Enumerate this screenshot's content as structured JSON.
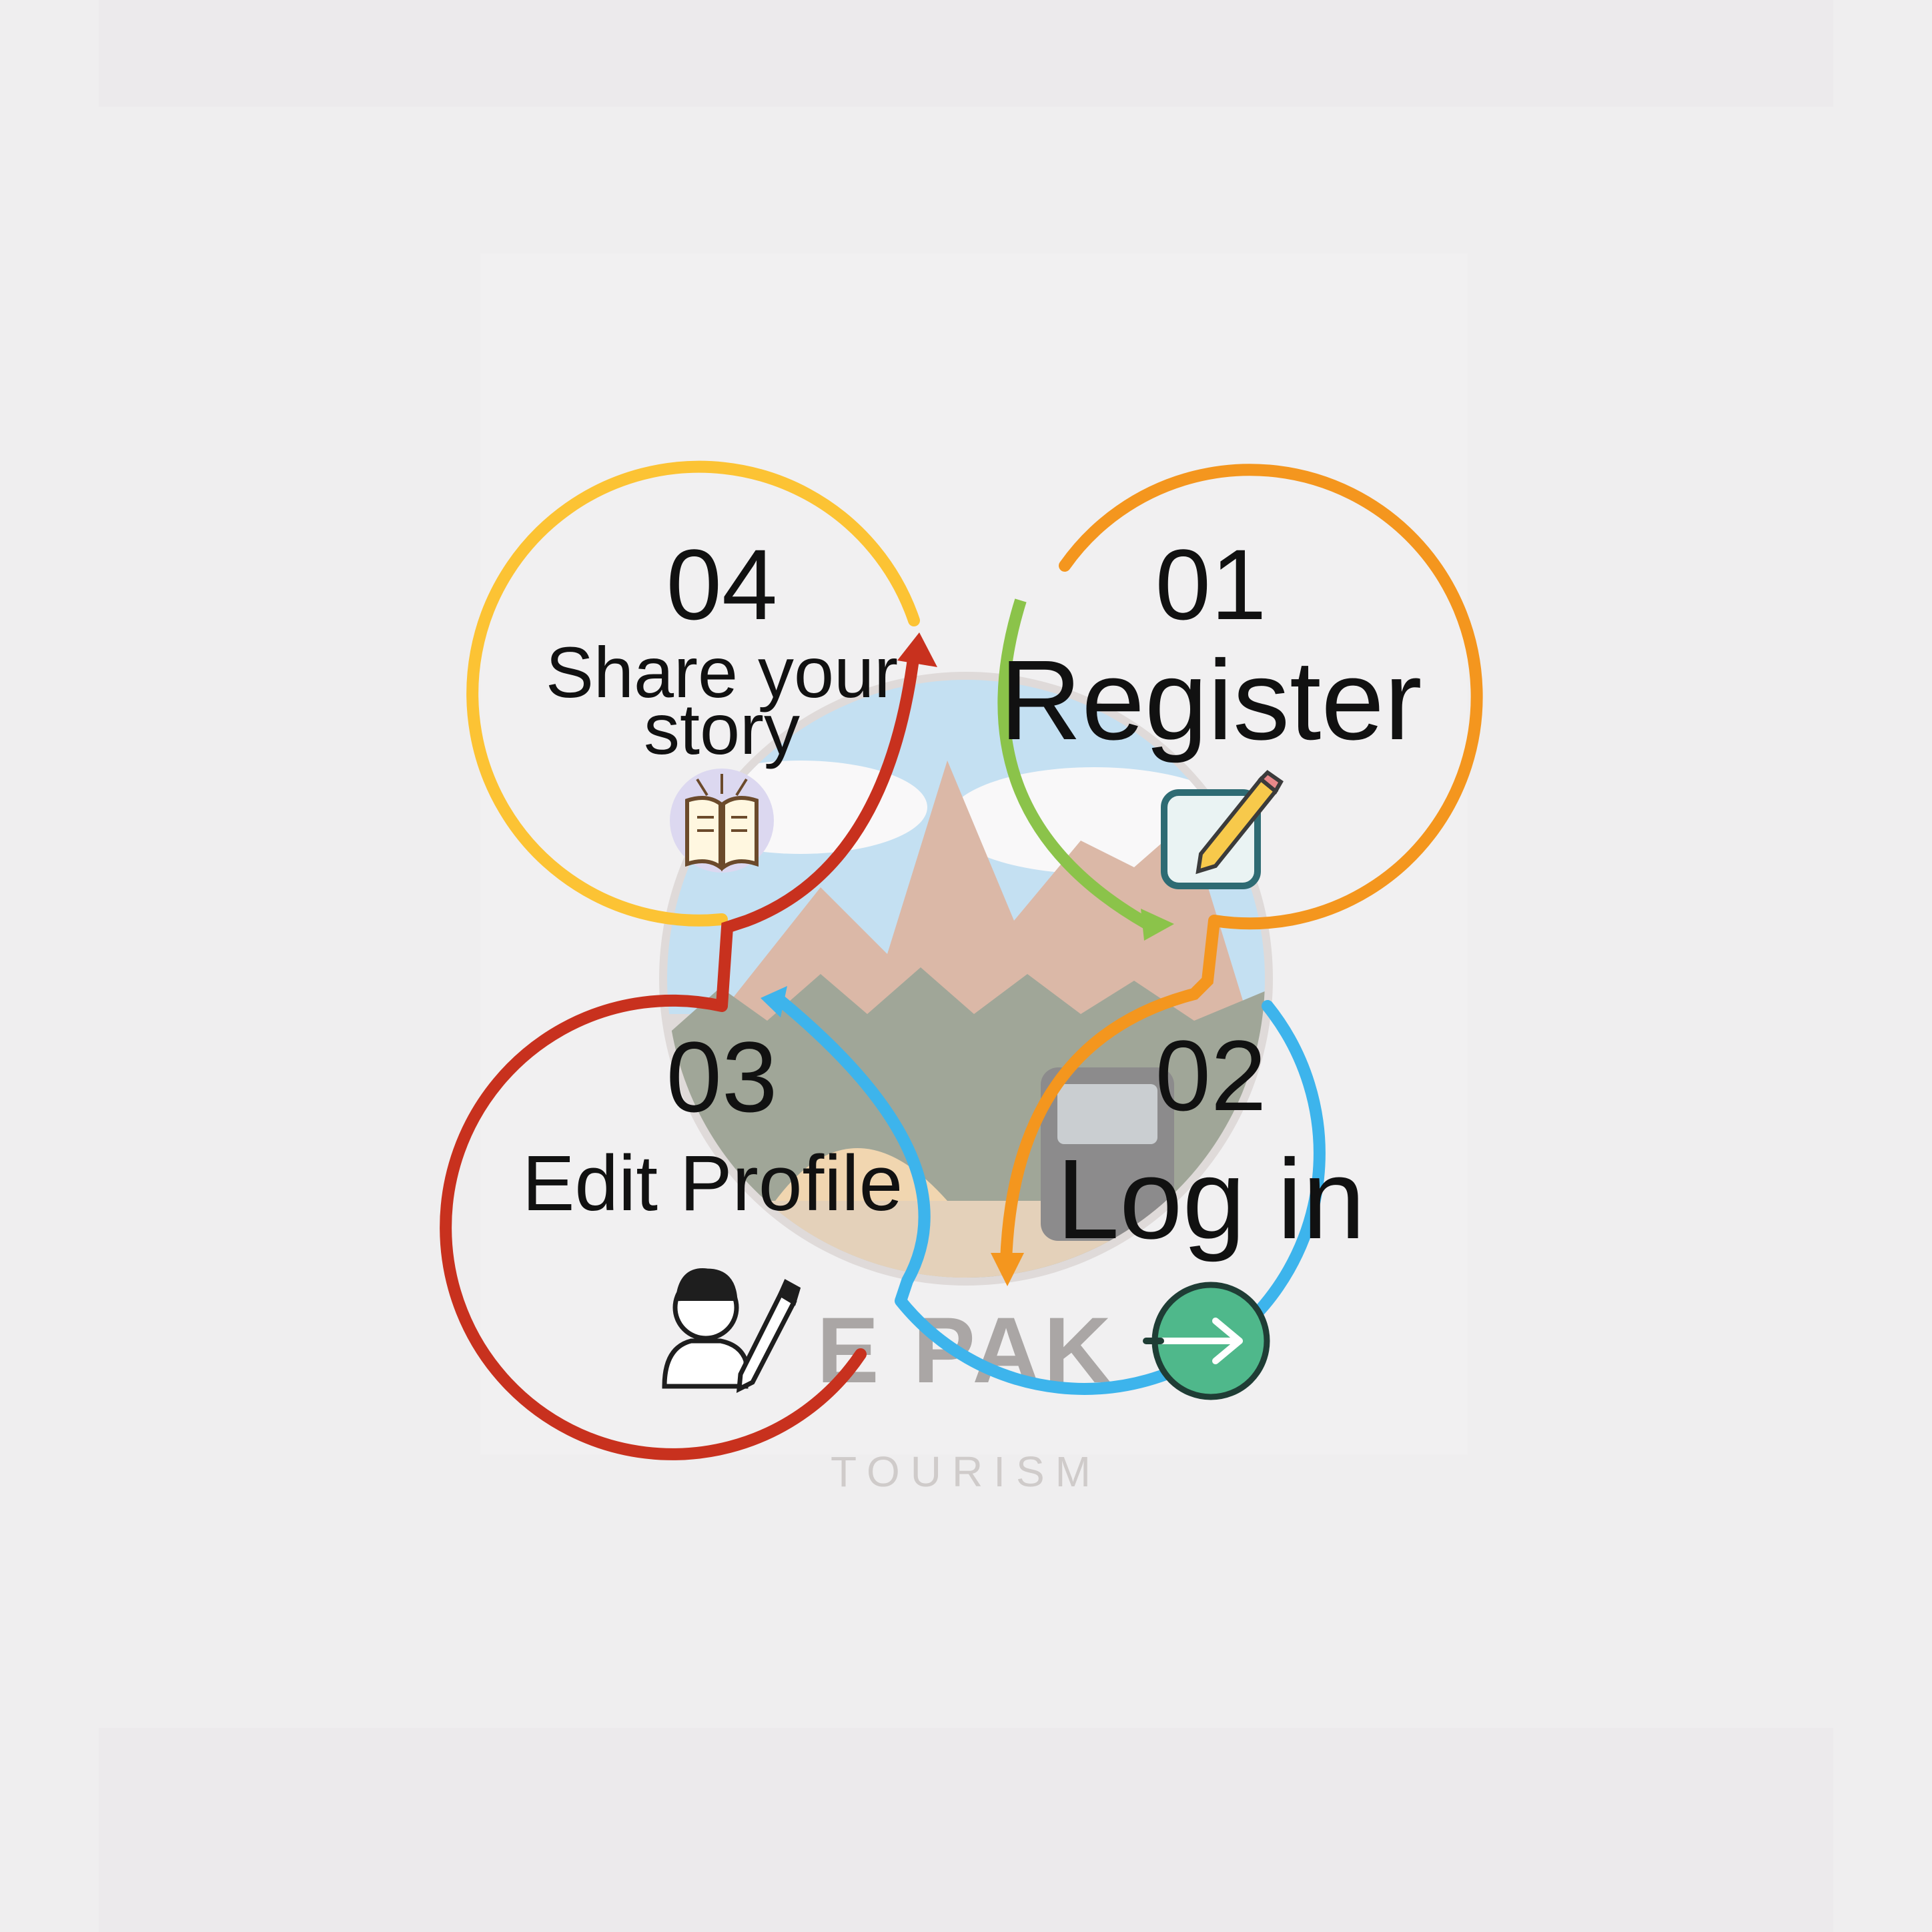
{
  "steps": [
    {
      "number": "01",
      "label": "Register",
      "icon": "notepad-pencil-icon",
      "color": "#f4961e"
    },
    {
      "number": "02",
      "label": "Log in",
      "icon": "login-arrow-icon",
      "color": "#3db4ec"
    },
    {
      "number": "03",
      "label": "Edit Profile",
      "icon": "user-edit-icon",
      "color": "#c8311e"
    },
    {
      "number": "04",
      "label_line1": "Share your",
      "label_line2": "story",
      "icon": "open-book-icon",
      "color": "#fcc334"
    }
  ],
  "logo": {
    "brand": "E PAK",
    "tagline": "TOURISM"
  },
  "colors": {
    "background": "#efeeef",
    "green_arrow": "#8bc34a",
    "login_circle": "#4fb88b"
  }
}
